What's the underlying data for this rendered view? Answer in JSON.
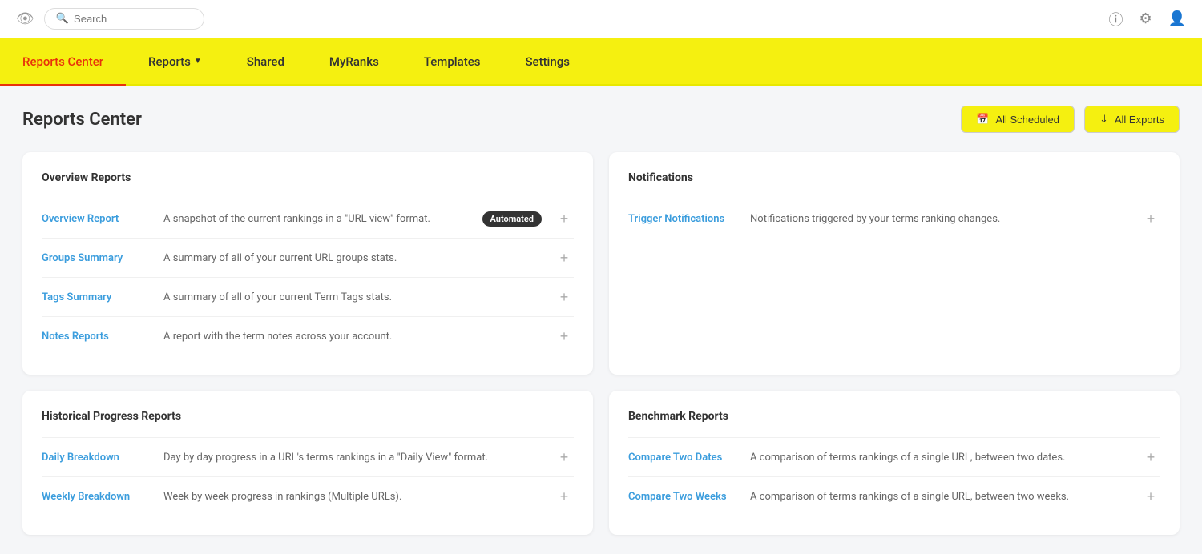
{
  "topbar": {
    "search_placeholder": "Search",
    "eye_icon": "👁",
    "help_icon": "?",
    "settings_icon": "⚙",
    "user_icon": "👤"
  },
  "nav": {
    "items": [
      {
        "label": "Reports Center",
        "active": true,
        "dropdown": false
      },
      {
        "label": "Reports",
        "active": false,
        "dropdown": true
      },
      {
        "label": "Shared",
        "active": false,
        "dropdown": false
      },
      {
        "label": "MyRanks",
        "active": false,
        "dropdown": false
      },
      {
        "label": "Templates",
        "active": false,
        "dropdown": false
      },
      {
        "label": "Settings",
        "active": false,
        "dropdown": false
      }
    ]
  },
  "page": {
    "title": "Reports Center",
    "actions": {
      "scheduled_label": "All Scheduled",
      "exports_label": "All Exports"
    }
  },
  "overview_section": {
    "title": "Overview Reports",
    "reports": [
      {
        "link": "Overview Report",
        "desc": "A snapshot of the current rankings in a \"URL view\" format.",
        "badge": "Automated"
      },
      {
        "link": "Groups Summary",
        "desc": "A summary of all of your current URL groups stats.",
        "badge": null
      },
      {
        "link": "Tags Summary",
        "desc": "A summary of all of your current Term Tags stats.",
        "badge": null
      },
      {
        "link": "Notes Reports",
        "desc": "A report with the term notes across your account.",
        "badge": null
      }
    ]
  },
  "notifications_section": {
    "title": "Notifications",
    "reports": [
      {
        "link": "Trigger Notifications",
        "desc": "Notifications triggered by your terms ranking changes.",
        "badge": null
      }
    ]
  },
  "historical_section": {
    "title": "Historical Progress Reports",
    "reports": [
      {
        "link": "Daily Breakdown",
        "desc": "Day by day progress in a URL's terms rankings in a \"Daily View\" format.",
        "badge": null
      },
      {
        "link": "Weekly Breakdown",
        "desc": "Week by week progress in rankings (Multiple URLs).",
        "badge": null
      }
    ]
  },
  "benchmark_section": {
    "title": "Benchmark Reports",
    "reports": [
      {
        "link": "Compare Two Dates",
        "desc": "A comparison of terms rankings of a single URL, between two dates.",
        "badge": null
      },
      {
        "link": "Compare Two Weeks",
        "desc": "A comparison of terms rankings of a single URL, between two weeks.",
        "badge": null
      }
    ]
  }
}
